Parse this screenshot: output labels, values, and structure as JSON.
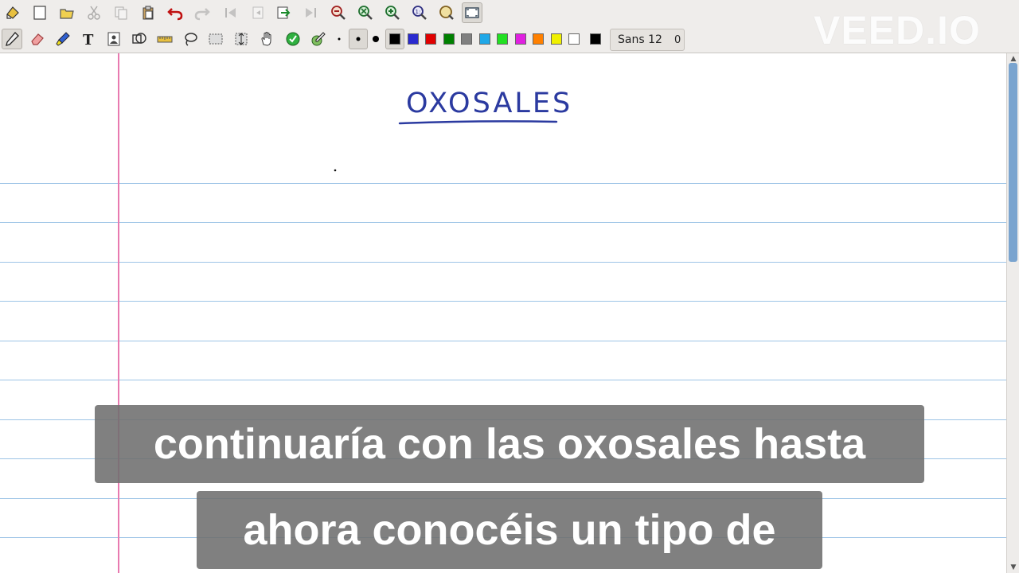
{
  "toolbar": {
    "font_name": "Sans 12",
    "font_size": "0",
    "colors": [
      "#000000",
      "#2a2acf",
      "#e00000",
      "#008000",
      "#808080",
      "#20a8e8",
      "#22e022",
      "#e020e0",
      "#ff8000",
      "#f0f000",
      "#ffffff"
    ],
    "current_color": "#000000"
  },
  "watermark": {
    "text": "VEED.IO"
  },
  "note": {
    "title": "OXOSALES",
    "ink_color": "#2b3aa0"
  },
  "captions": {
    "line1": "continuaría con las oxosales hasta",
    "line2": "ahora conocéis un tipo de"
  }
}
